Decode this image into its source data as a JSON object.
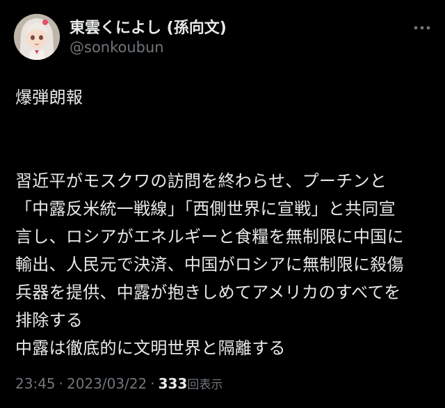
{
  "author": {
    "display_name": "東雲くによし (孫向文)",
    "handle": "@sonkoubun"
  },
  "tweet": {
    "headline": "爆弾朗報",
    "lines": [
      "習近平がモスクワの訪問を終わらせ、プーチンと",
      "「中露反米統一戦線」「西側世界に宣戦」と共同宣",
      "言し、ロシアがエネルギーと食糧を無制限に中国に",
      "輸出、人民元で決済、中国がロシアに無制限に殺傷",
      "兵器を提供、中露が抱きしめてアメリカのすべてを",
      "排除する",
      "中露は徹底的に文明世界と隔離する"
    ]
  },
  "meta": {
    "time": "23:45",
    "separator": "·",
    "date": "2023/03/22",
    "views_count": "333",
    "views_label": "回表示"
  },
  "icons": {
    "more": "more-horizontal-icon",
    "avatar": "avatar-anime-girl"
  },
  "colors": {
    "background": "#000000",
    "primary_text": "#e7e9ea",
    "secondary_text": "#71767b"
  }
}
